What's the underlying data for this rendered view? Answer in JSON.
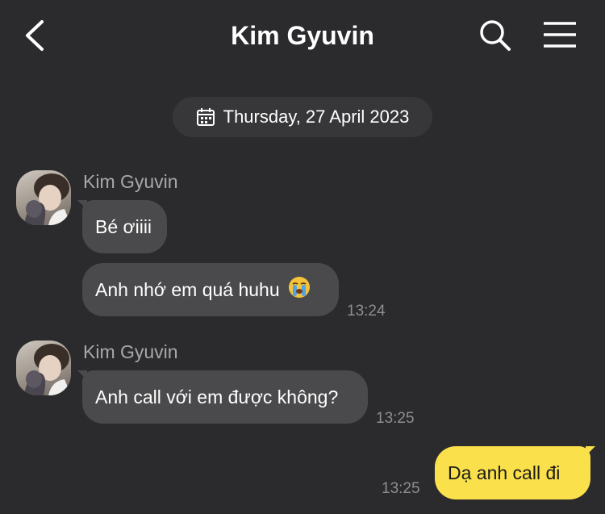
{
  "header": {
    "title": "Kim Gyuvin",
    "back_icon": "chevron-left-icon",
    "search_icon": "search-icon",
    "menu_icon": "hamburger-menu-icon"
  },
  "date_divider": {
    "icon": "calendar-icon",
    "label": "Thursday, 27 April 2023"
  },
  "messages": [
    {
      "sender": "Kim Gyuvin",
      "bubbles": [
        {
          "text": "Bé ơiiii"
        },
        {
          "text": "Anh nhớ em quá huhu",
          "emoji": "😭",
          "time": "13:24"
        }
      ]
    },
    {
      "sender": "Kim Gyuvin",
      "bubbles": [
        {
          "text": "Anh call với em được không?",
          "time": "13:25"
        }
      ]
    },
    {
      "sender": "me",
      "bubbles": [
        {
          "text": "Dạ anh call đi",
          "time": "13:25"
        }
      ]
    }
  ],
  "colors": {
    "background": "#2b2b2d",
    "incoming_bubble": "#4a4a4c",
    "outgoing_bubble": "#fae04a",
    "timestamp": "#8e8e90"
  }
}
